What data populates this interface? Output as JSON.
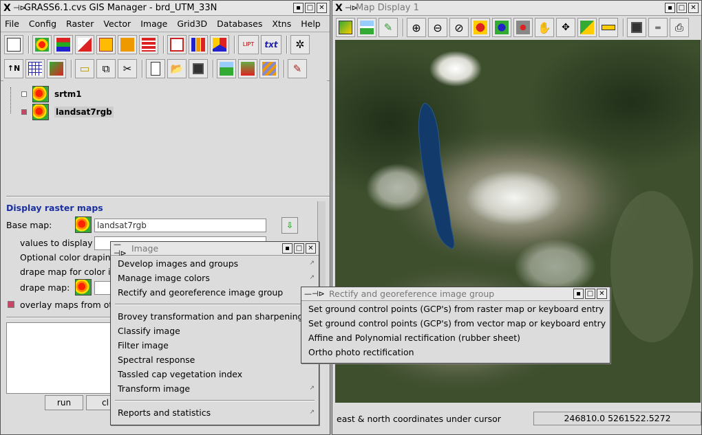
{
  "gis_manager": {
    "title": "GRASS6.1.cvs GIS Manager - brd_UTM_33N",
    "menu": [
      "File",
      "Config",
      "Raster",
      "Vector",
      "Image",
      "Grid3D",
      "Databases",
      "Xtns",
      "Help"
    ],
    "toolbar_text_icon": "txt",
    "layers": [
      {
        "name": "srtm1",
        "checked": false
      },
      {
        "name": "landsat7rgb",
        "checked": true
      }
    ],
    "options": {
      "heading": "Display raster maps",
      "base_map_label": "Base map:",
      "base_map_value": "landsat7rgb",
      "values_label": "values to display",
      "optional_draping_label": "Optional color draping",
      "drape_for_color_label": "drape map for color in",
      "drape_map_label": "drape map:",
      "overlay_label": "overlay maps from oth"
    },
    "run_label": "run",
    "clear_label_partial": "cl"
  },
  "image_menu": {
    "title": "Image",
    "items_top": [
      "Develop images and groups",
      "Manage image colors",
      "Rectify and georeference image group"
    ],
    "items_mid": [
      "Brovey transformation and pan sharpening",
      "Classify image",
      "Filter image",
      "Spectral response",
      "Tassled cap vegetation index",
      "Transform image"
    ],
    "items_bottom": [
      "Reports and statistics"
    ]
  },
  "rectify_menu": {
    "title": "Rectify and georeference image group",
    "items": [
      "Set ground control points (GCP's) from raster map or keyboard entry",
      "Set ground control points (GCP's) from vector map or keyboard entry",
      "Affine and Polynomial rectification (rubber sheet)",
      "Ortho photo rectification"
    ]
  },
  "map_display": {
    "title": "Map Display 1",
    "status_label": "east & north coordinates under cursor",
    "coordinates": "246810.0 5261522.5272"
  }
}
